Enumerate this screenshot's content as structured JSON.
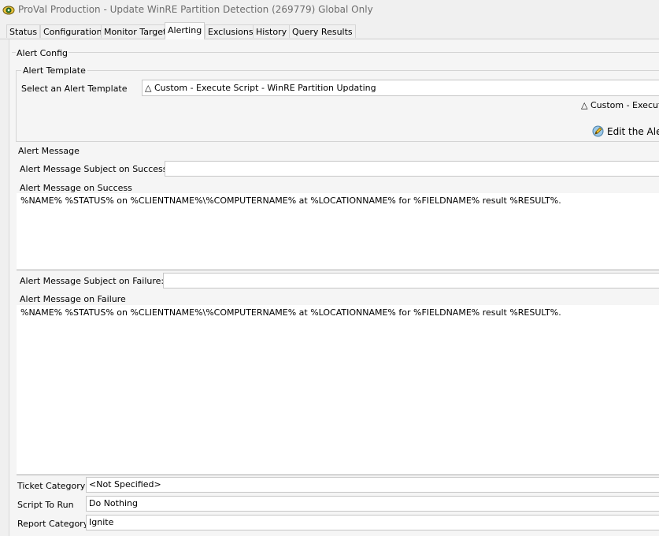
{
  "window": {
    "title": "ProVal Production - Update WinRE Partition Detection (269779) Global Only"
  },
  "tabs": [
    {
      "label": "Status",
      "active": false
    },
    {
      "label": "Configuration",
      "active": false
    },
    {
      "label": "Monitor Target",
      "active": false
    },
    {
      "label": "Alerting",
      "active": true
    },
    {
      "label": "Exclusions",
      "active": false
    },
    {
      "label": "History",
      "active": false
    },
    {
      "label": "Query Results",
      "active": false
    }
  ],
  "alert_config": {
    "group_label": "Alert Config",
    "template": {
      "group_label": "Alert Template",
      "select_label": "Select an Alert Template",
      "selected_value": "△ Custom - Execute Script - WinRE Partition Updating",
      "preview_text": "△ Custom - Execute",
      "edit_label": "Edit the Alert"
    },
    "message": {
      "group_label": "Alert Message",
      "subject_success_label": "Alert Message Subject on Success:",
      "subject_success_value": "",
      "success_label": "Alert Message on Success",
      "success_value": "%NAME% %STATUS% on %CLIENTNAME%\\%COMPUTERNAME% at %LOCATIONNAME% for %FIELDNAME% result %RESULT%.",
      "subject_failure_label": "Alert Message Subject on Failure:",
      "subject_failure_value": "",
      "failure_label": "Alert Message on Failure",
      "failure_value": "%NAME% %STATUS% on %CLIENTNAME%\\%COMPUTERNAME% at %LOCATIONNAME% for %FIELDNAME% result %RESULT%."
    }
  },
  "bottom": {
    "ticket_category_label": "Ticket Category",
    "ticket_category_value": "<Not Specified>",
    "script_label": "Script To Run",
    "script_value": "Do Nothing",
    "report_category_label": "Report Category",
    "report_category_value": "Ignite"
  },
  "colors": {
    "background": "#f0f0f0",
    "panel": "#f5f5f5",
    "field": "#ffffff",
    "title_text": "#6d6d6d"
  },
  "icons": {
    "title": "app-monitor-icon",
    "edit": "edit-alert-icon"
  }
}
